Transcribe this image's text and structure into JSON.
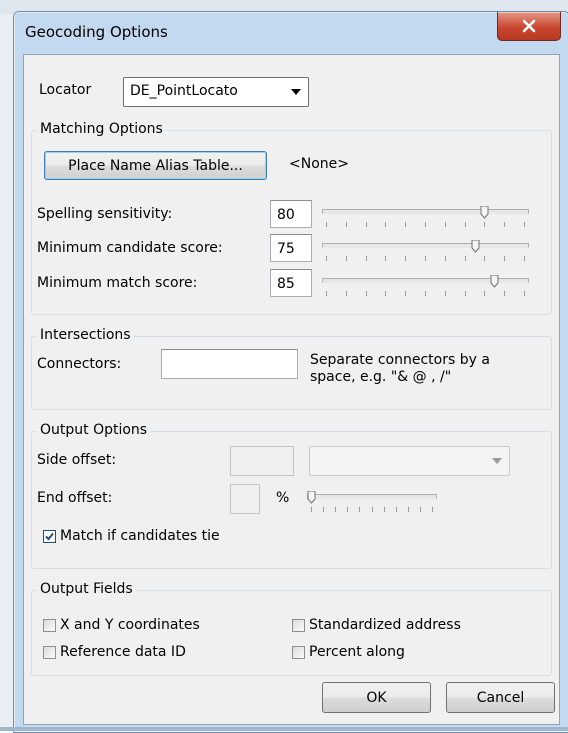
{
  "window": {
    "title": "Geocoding Options",
    "close_glyph": "close-icon"
  },
  "locator": {
    "label": "Locator",
    "value": "DE_PointLocato"
  },
  "matching": {
    "title": "Matching Options",
    "alias_button": "Place Name Alias Table...",
    "alias_value": "<None>",
    "spelling": {
      "label": "Spelling sensitivity:",
      "value": "80",
      "level": 0.8
    },
    "candidate": {
      "label": "Minimum candidate score:",
      "value": "75",
      "level": 0.75
    },
    "match": {
      "label": "Minimum match score:",
      "value": "85",
      "level": 0.85
    }
  },
  "intersections": {
    "title": "Intersections",
    "connectors_label": "Connectors:",
    "connectors_value": "",
    "hint_line1": "Separate connectors by a",
    "hint_line2": "space, e.g. \"& @ , /\""
  },
  "output_options": {
    "title": "Output Options",
    "side_offset_label": "Side offset:",
    "side_offset_value": "",
    "side_offset_unit": "",
    "end_offset_label": "End offset:",
    "end_offset_value": "",
    "end_offset_unit": "%",
    "end_offset_level": 0.0,
    "tie_label": "Match if candidates tie",
    "tie_checked": true
  },
  "output_fields": {
    "title": "Output Fields",
    "xy": {
      "label": "X and Y coordinates",
      "checked": false
    },
    "standardized": {
      "label": "Standardized address",
      "checked": false
    },
    "reference": {
      "label": "Reference data ID",
      "checked": false
    },
    "percent": {
      "label": "Percent along",
      "checked": false
    }
  },
  "buttons": {
    "ok": "OK",
    "cancel": "Cancel"
  },
  "colors": {
    "titlebar": "#c3d9ef",
    "close": "#c9462f",
    "client": "#f0f0f0",
    "check": "#1c5180"
  }
}
